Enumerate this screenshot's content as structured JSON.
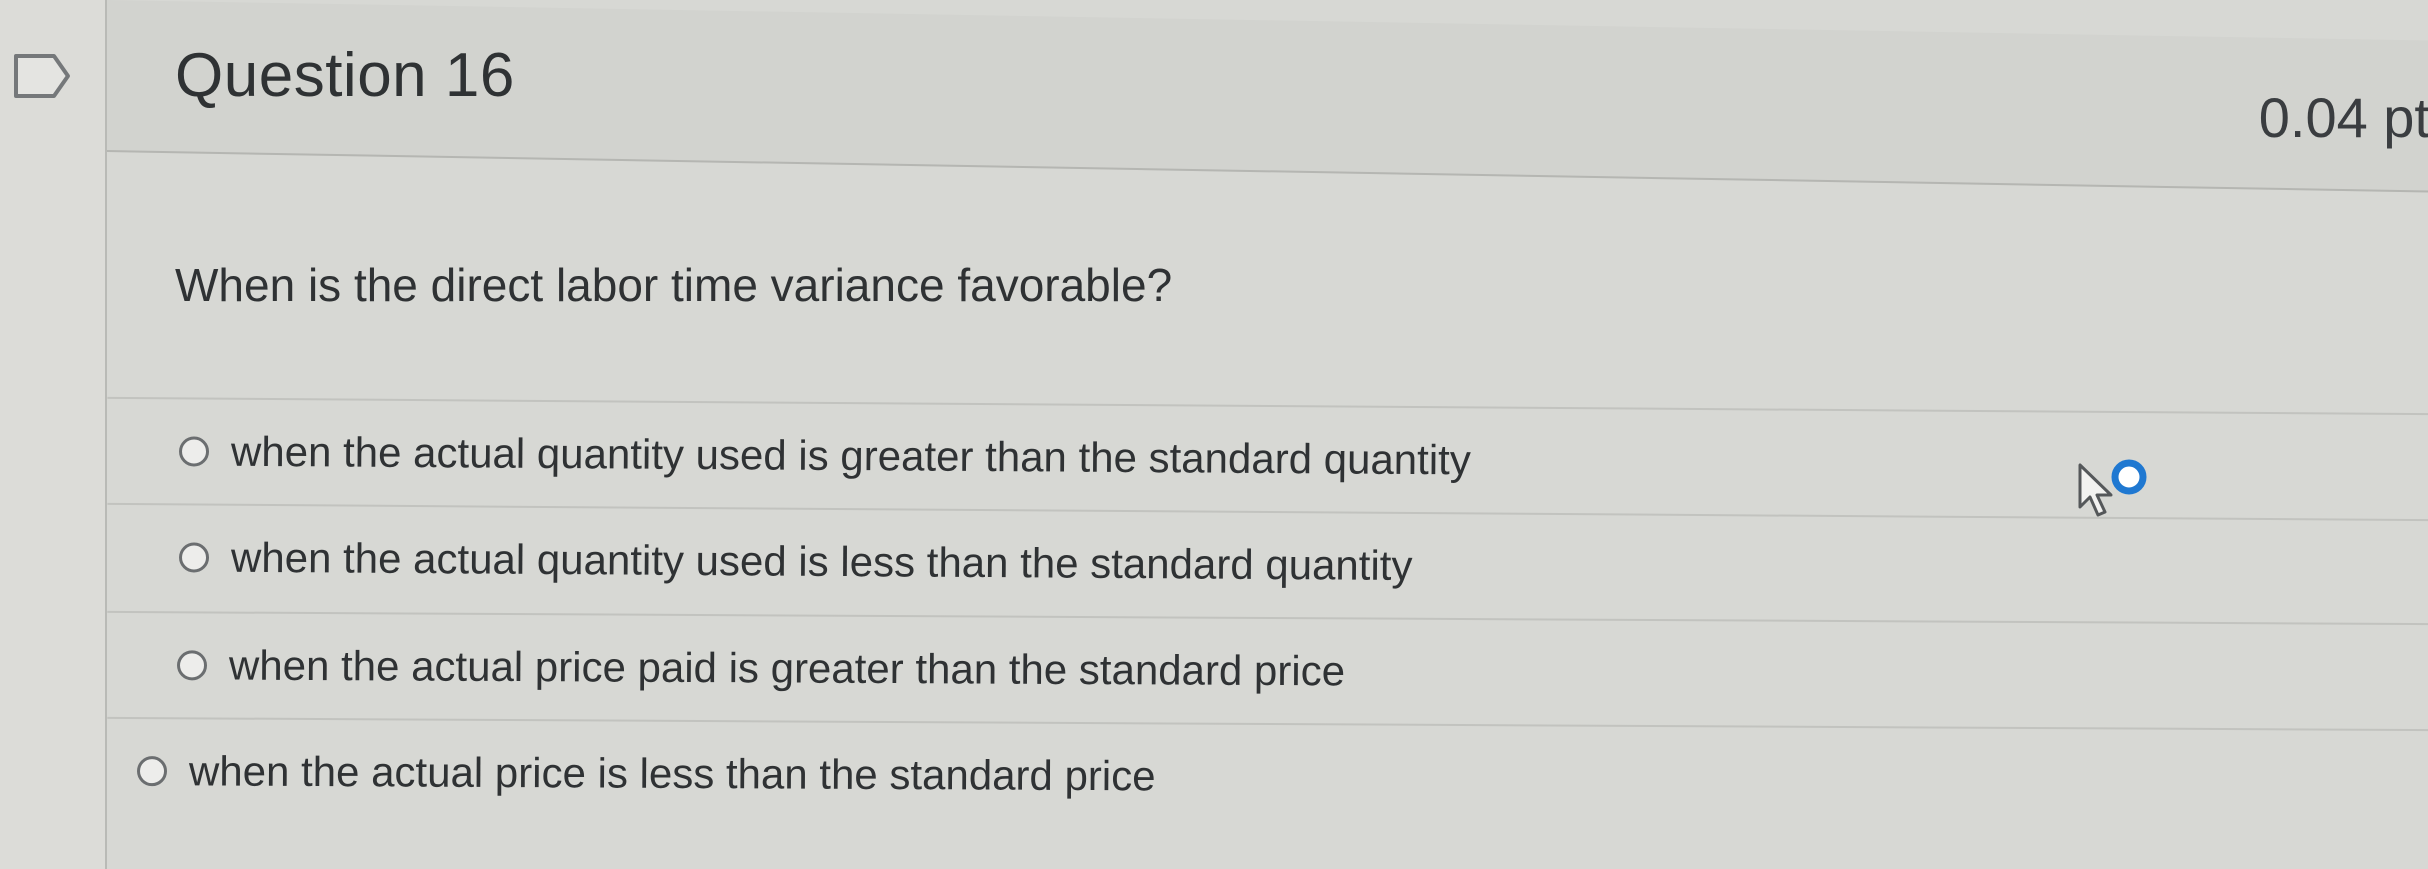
{
  "question": {
    "title": "Question 16",
    "points": "0.04 pt",
    "text": "When is the direct labor time variance favorable?"
  },
  "answers": [
    {
      "label": "when the actual quantity used is greater than the standard quantity",
      "selected": false
    },
    {
      "label": "when the actual quantity used is less than the standard quantity",
      "selected": false
    },
    {
      "label": "when the actual price paid is greater than the standard price",
      "selected": false
    },
    {
      "label": "when the actual price is less than the standard price",
      "selected": false
    }
  ],
  "icons": {
    "flag": "flag-question-icon",
    "cursor": "mouse-pointer-icon"
  },
  "colors": {
    "cursor_accent": "#1f78d1",
    "text": "#2f3234"
  }
}
